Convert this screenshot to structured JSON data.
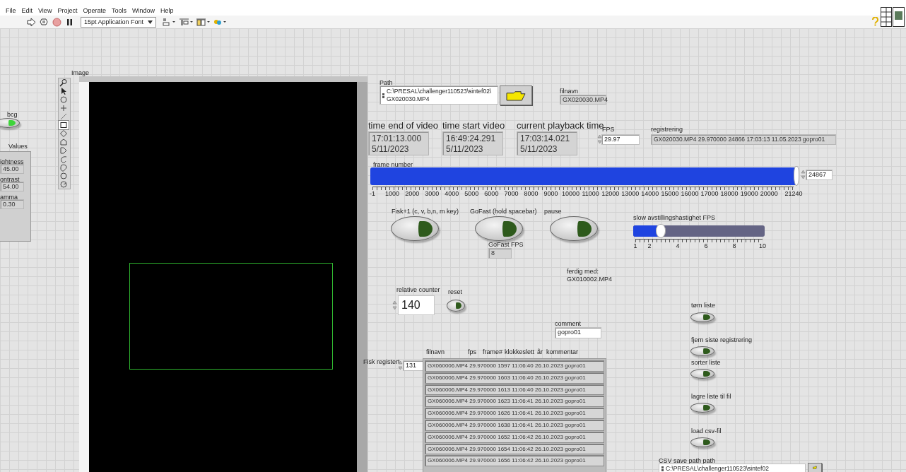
{
  "menu": [
    "File",
    "Edit",
    "View",
    "Project",
    "Operate",
    "Tools",
    "Window",
    "Help"
  ],
  "toolbar": {
    "font": "15pt Application Font"
  },
  "bcg": {
    "label": "bcg",
    "on": true
  },
  "values": {
    "title": "Values",
    "items": [
      {
        "label": "ightness",
        "value": "45.00"
      },
      {
        "label": "ontrast",
        "value": "54.00"
      },
      {
        "label": "amma",
        "value": "0.30"
      }
    ]
  },
  "image": {
    "label": "Image",
    "tools": [
      {
        "kind": "zoom",
        "selected": false
      },
      {
        "kind": "pointer",
        "selected": false
      },
      {
        "kind": "pan",
        "selected": false
      },
      {
        "kind": "point",
        "selected": false
      },
      {
        "kind": "line",
        "selected": false
      },
      {
        "kind": "rectangle",
        "selected": true
      },
      {
        "kind": "rotated-rectangle",
        "selected": false
      },
      {
        "kind": "polygon",
        "selected": false
      },
      {
        "kind": "freehand-region",
        "selected": false
      },
      {
        "kind": "freehand-line",
        "selected": false
      },
      {
        "kind": "blob",
        "selected": false
      },
      {
        "kind": "oval",
        "selected": false
      },
      {
        "kind": "annulus",
        "selected": false
      }
    ]
  },
  "path": {
    "label": "Path",
    "lines": [
      "C:\\PRESAL\\challenger110523\\sintef02\\",
      "GX020030.MP4"
    ]
  },
  "filnavn": {
    "label": "filnavn",
    "value": "GX020030.MP4"
  },
  "times": [
    {
      "label": "time end of video",
      "time": "17:01:13.000",
      "date": "5/11/2023"
    },
    {
      "label": "time start video",
      "time": "16:49:24.291",
      "date": "5/11/2023"
    },
    {
      "label": "current playback time",
      "time": "17:03:14.021",
      "date": "5/11/2023"
    }
  ],
  "fps": {
    "label": "FPS",
    "value": "29.97"
  },
  "registrering": {
    "label": "registrering",
    "value": "GX020030.MP4 29.970000 24866 17:03:13 11.05.2023 gopro01"
  },
  "frame_number": {
    "label": "frame number",
    "level": 0.995,
    "value": "24867",
    "scale": [
      "-1",
      "1000",
      "2000",
      "3000",
      "4000",
      "5000",
      "6000",
      "7000",
      "8000",
      "9000",
      "10000",
      "11000",
      "12000",
      "13000",
      "14000",
      "15000",
      "16000",
      "17000",
      "18000",
      "19000",
      "20000",
      "21240"
    ]
  },
  "buttons": [
    {
      "label": "Fisk+1 (c, v, b,n, m key)",
      "on": false
    },
    {
      "label": "GoFast (hold spacebar)",
      "on": false
    },
    {
      "label": "pause",
      "on": false
    }
  ],
  "gofast_fps": {
    "label": "GoFast FPS",
    "value": "8"
  },
  "slow_slider": {
    "label": "slow avstillingshastighet FPS",
    "level": 0.21,
    "scale": [
      "1",
      "2",
      "4",
      "6",
      "8",
      "10"
    ]
  },
  "status": {
    "label": "ferdig med:",
    "value": "GX010002.MP4"
  },
  "relative_counter": {
    "label": "relative counter",
    "value": "140"
  },
  "reset": {
    "label": "reset",
    "on": false
  },
  "comment": {
    "label": "comment",
    "value": "gopro01"
  },
  "list_buttons": [
    {
      "label": "tøm liste",
      "on": false
    },
    {
      "label": "fjern siste registrering",
      "on": false
    },
    {
      "label": "sorter liste",
      "on": false
    },
    {
      "label": "lagre liste til fil",
      "on": false
    },
    {
      "label": "load csv-fil",
      "on": false
    }
  ],
  "csv_path": {
    "label": "CSV save path path",
    "value": "C:\\PRESAL\\challenger110523\\sintef02"
  },
  "fisk_registert": {
    "label": "Fisk registert",
    "value": "131"
  },
  "list": {
    "columns": [
      "filnavn",
      "fps",
      "frame#",
      "klokkeslett",
      "år",
      "kommentar"
    ],
    "rows": [
      "GX060006.MP4 29.970000 1597 11:06:40 26.10.2023 gopro01",
      "GX060006.MP4 29.970000 1603 11:06:40 26.10.2023 gopro01",
      "GX060006.MP4 29.970000 1613 11:06:40 26.10.2023 gopro01",
      "GX060006.MP4 29.970000 1623 11:06:41 26.10.2023 gopro01",
      "GX060006.MP4 29.970000 1626 11:06:41 26.10.2023 gopro01",
      "GX060006.MP4 29.970000 1638 11:06:41 26.10.2023 gopro01",
      "GX060006.MP4 29.970000 1652 11:06:42 26.10.2023 gopro01",
      "GX060006.MP4 29.970000 1654 11:06:42 26.10.2023 gopro01",
      "GX060006.MP4 29.970000 1656 11:06:42 26.10.2023 gopro01"
    ]
  }
}
